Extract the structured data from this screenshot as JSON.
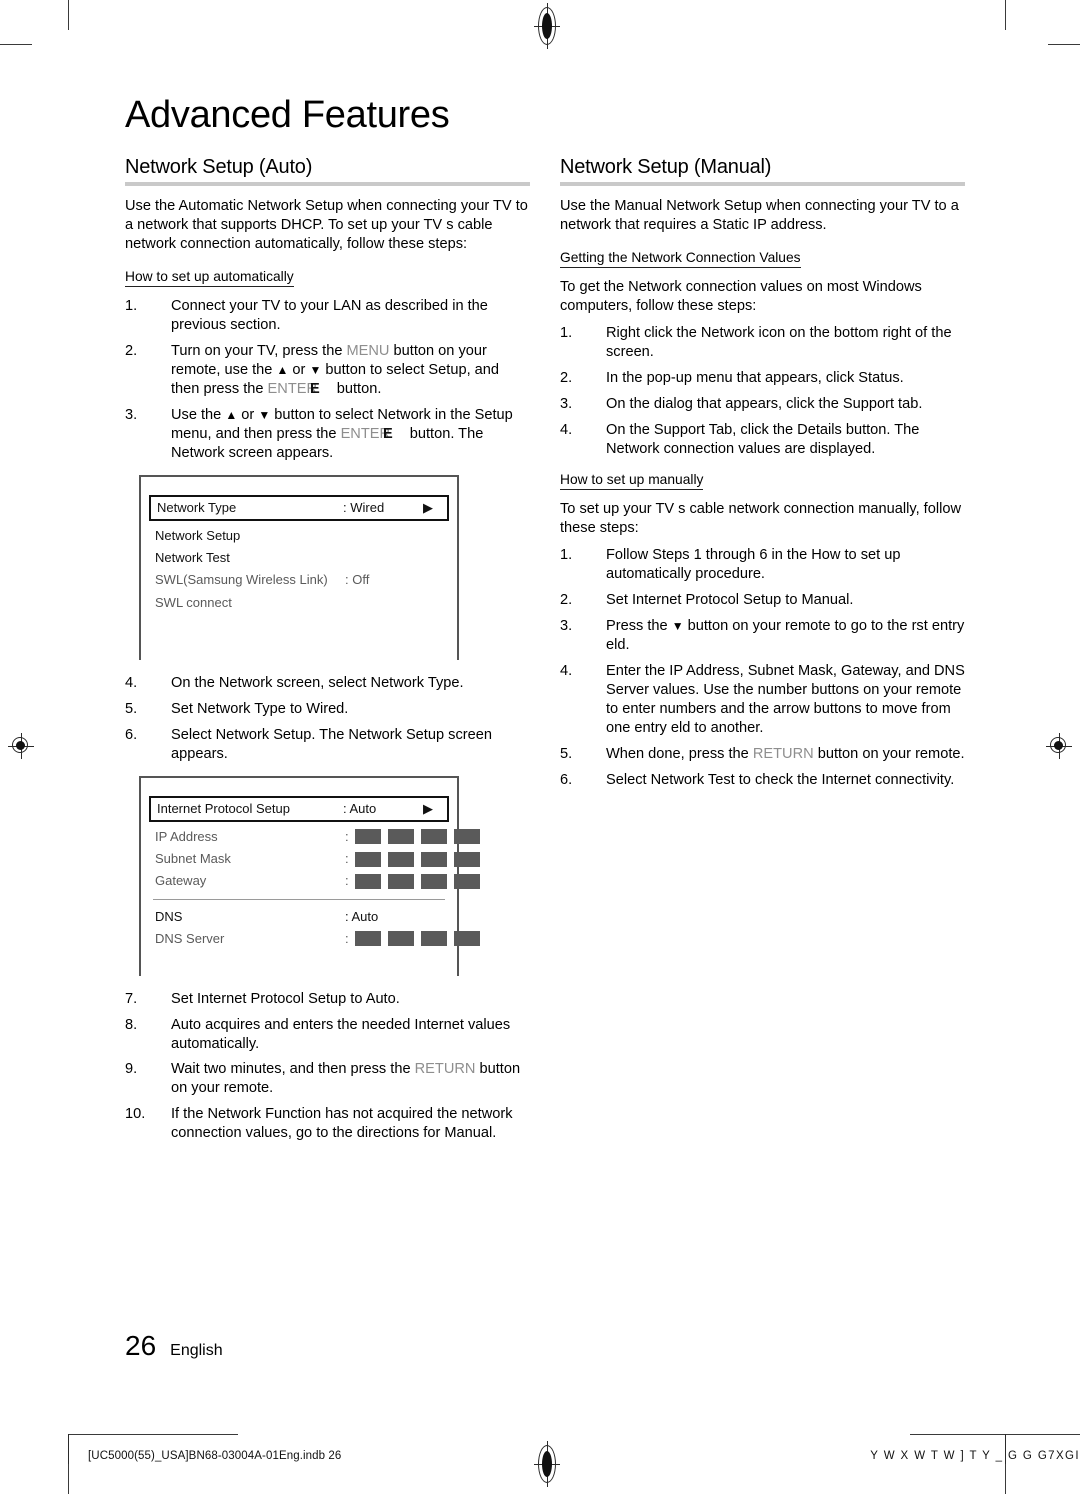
{
  "document": {
    "title": "Advanced Features",
    "page_number": "26",
    "language": "English",
    "footer_left": "[UC5000(55)_USA]BN68-03004A-01Eng.indb   26",
    "footer_right": "Y W X W T W ] T Y _ G  G G7XGI"
  },
  "left_column": {
    "section_title": "Network Setup (Auto)",
    "intro": "Use the Automatic Network Setup when connecting your TV to a network that supports DHCP. To set up your TV s cable network connection automatically, follow these steps:",
    "subhead": "How to set up automatically",
    "steps_1_3": [
      {
        "num": "1.",
        "parts": [
          {
            "t": "Connect your TV to your LAN as described in the previous section.",
            "s": "normal"
          }
        ]
      },
      {
        "num": "2.",
        "parts": [
          {
            "t": "Turn on your TV, press the ",
            "s": "normal"
          },
          {
            "t": "MENU",
            "s": "kbd"
          },
          {
            "t": " button on your remote, use the ",
            "s": "normal"
          },
          {
            "t": "▲",
            "s": "arrow"
          },
          {
            "t": " or ",
            "s": "normal"
          },
          {
            "t": "▼",
            "s": "arrow"
          },
          {
            "t": " button to select Setup, and then press the ",
            "s": "normal"
          },
          {
            "t": "ENTER",
            "s": "kbd"
          },
          {
            "t": "E",
            "s": "enter-glyph"
          },
          {
            "t": "button.",
            "s": "normal"
          }
        ]
      },
      {
        "num": "3.",
        "parts": [
          {
            "t": "Use the ",
            "s": "normal"
          },
          {
            "t": "▲",
            "s": "arrow"
          },
          {
            "t": " or ",
            "s": "normal"
          },
          {
            "t": "▼",
            "s": "arrow"
          },
          {
            "t": " button to select Network in the Setup menu, and then press the ",
            "s": "normal"
          },
          {
            "t": "ENTER",
            "s": "kbd"
          },
          {
            "t": "E",
            "s": "enter-glyph"
          },
          {
            "t": "button. The Network screen appears.",
            "s": "normal"
          }
        ]
      }
    ],
    "screen_network": {
      "rows": [
        {
          "label": "Network Type",
          "value": ": Wired",
          "caret": "▶",
          "selected": true,
          "dim": false
        },
        {
          "label": "Network Setup",
          "value": "",
          "caret": "",
          "selected": false,
          "dim": false
        },
        {
          "label": "Network Test",
          "value": "",
          "caret": "",
          "selected": false,
          "dim": false
        },
        {
          "label": "SWL(Samsung Wireless Link)",
          "value": ": Off",
          "caret": "",
          "selected": false,
          "dim": true
        },
        {
          "label": "SWL connect",
          "value": "",
          "caret": "",
          "selected": false,
          "dim": true
        }
      ]
    },
    "steps_4_6": [
      {
        "num": "4.",
        "parts": [
          {
            "t": "On the Network screen, select Network Type.",
            "s": "normal"
          }
        ]
      },
      {
        "num": "5.",
        "parts": [
          {
            "t": "Set Network Type to Wired.",
            "s": "normal"
          }
        ]
      },
      {
        "num": "6.",
        "parts": [
          {
            "t": "Select Network Setup. The Network Setup screen appears.",
            "s": "normal"
          }
        ]
      }
    ],
    "screen_ip": {
      "rows": [
        {
          "label": "Internet Protocol Setup",
          "value": ": Auto",
          "caret": "▶",
          "type": "selected"
        },
        {
          "label": "IP Address",
          "value": ":",
          "type": "blocks-dim"
        },
        {
          "label": "Subnet Mask",
          "value": ":",
          "type": "blocks-dim"
        },
        {
          "label": "Gateway",
          "value": ":",
          "type": "blocks-dim"
        },
        {
          "label": "",
          "value": "",
          "type": "divider"
        },
        {
          "label": "DNS",
          "value": ": Auto",
          "type": "plain"
        },
        {
          "label": "DNS Server",
          "value": ":",
          "type": "blocks-dim"
        }
      ],
      "block_count": 4
    },
    "steps_7_10": [
      {
        "num": "7.",
        "parts": [
          {
            "t": "Set Internet Protocol Setup to Auto.",
            "s": "normal"
          }
        ]
      },
      {
        "num": "8.",
        "parts": [
          {
            "t": "Auto acquires and enters the needed Internet values automatically.",
            "s": "normal"
          }
        ]
      },
      {
        "num": "9.",
        "parts": [
          {
            "t": "Wait two minutes, and then press the ",
            "s": "normal"
          },
          {
            "t": "RETURN",
            "s": "kbd"
          },
          {
            "t": " button on your remote.",
            "s": "normal"
          }
        ]
      },
      {
        "num": "10.",
        "parts": [
          {
            "t": "If the Network Function has not acquired the network connection values, go to the directions for Manual.",
            "s": "normal"
          }
        ]
      }
    ]
  },
  "right_column": {
    "section_title": "Network Setup (Manual)",
    "intro": "Use the Manual Network Setup when connecting your TV to a network that requires a Static IP address.",
    "subhead_1": "Getting the Network Connection Values",
    "para_1": "To get the Network connection values on most Windows computers, follow these steps:",
    "steps_values": [
      {
        "num": "1.",
        "parts": [
          {
            "t": "Right click the Network icon on the bottom right of the screen.",
            "s": "normal"
          }
        ]
      },
      {
        "num": "2.",
        "parts": [
          {
            "t": "In the pop-up menu that appears, click Status.",
            "s": "normal"
          }
        ]
      },
      {
        "num": "3.",
        "parts": [
          {
            "t": "On the dialog that appears, click the Support tab.",
            "s": "normal"
          }
        ]
      },
      {
        "num": "4.",
        "parts": [
          {
            "t": "On the Support Tab, click the Details button. The Network connection values are displayed.",
            "s": "normal"
          }
        ]
      }
    ],
    "subhead_2": "How to set up manually",
    "para_2": "To set up your TV s cable network connection manually, follow these steps:",
    "steps_manual": [
      {
        "num": "1.",
        "parts": [
          {
            "t": "Follow Steps 1 through 6 in the  How to set up automatically  procedure.",
            "s": "normal"
          }
        ]
      },
      {
        "num": "2.",
        "parts": [
          {
            "t": "Set Internet Protocol Setup to Manual.",
            "s": "normal"
          }
        ]
      },
      {
        "num": "3.",
        "parts": [
          {
            "t": "Press the ",
            "s": "normal"
          },
          {
            "t": "▼",
            "s": "arrow"
          },
          {
            "t": " button on your remote to go to the  rst entry  eld.",
            "s": "normal"
          }
        ]
      },
      {
        "num": "4.",
        "parts": [
          {
            "t": "Enter the IP Address, Subnet Mask, Gateway, and DNS Server values. Use the number buttons on your remote to enter numbers and the arrow buttons to move from one entry  eld to another.",
            "s": "normal"
          }
        ]
      },
      {
        "num": "5.",
        "parts": [
          {
            "t": "When done, press the ",
            "s": "normal"
          },
          {
            "t": "RETURN",
            "s": "kbd"
          },
          {
            "t": " button on your remote.",
            "s": "normal"
          }
        ]
      },
      {
        "num": "6.",
        "parts": [
          {
            "t": "Select Network Test to check the Internet connectivity.",
            "s": "normal"
          }
        ]
      }
    ]
  },
  "colors": {
    "rule": "#c9c9c9",
    "keycap_text": "#8e8e8e",
    "screen_border": "#555555",
    "value_block": "#5a5a5a"
  }
}
